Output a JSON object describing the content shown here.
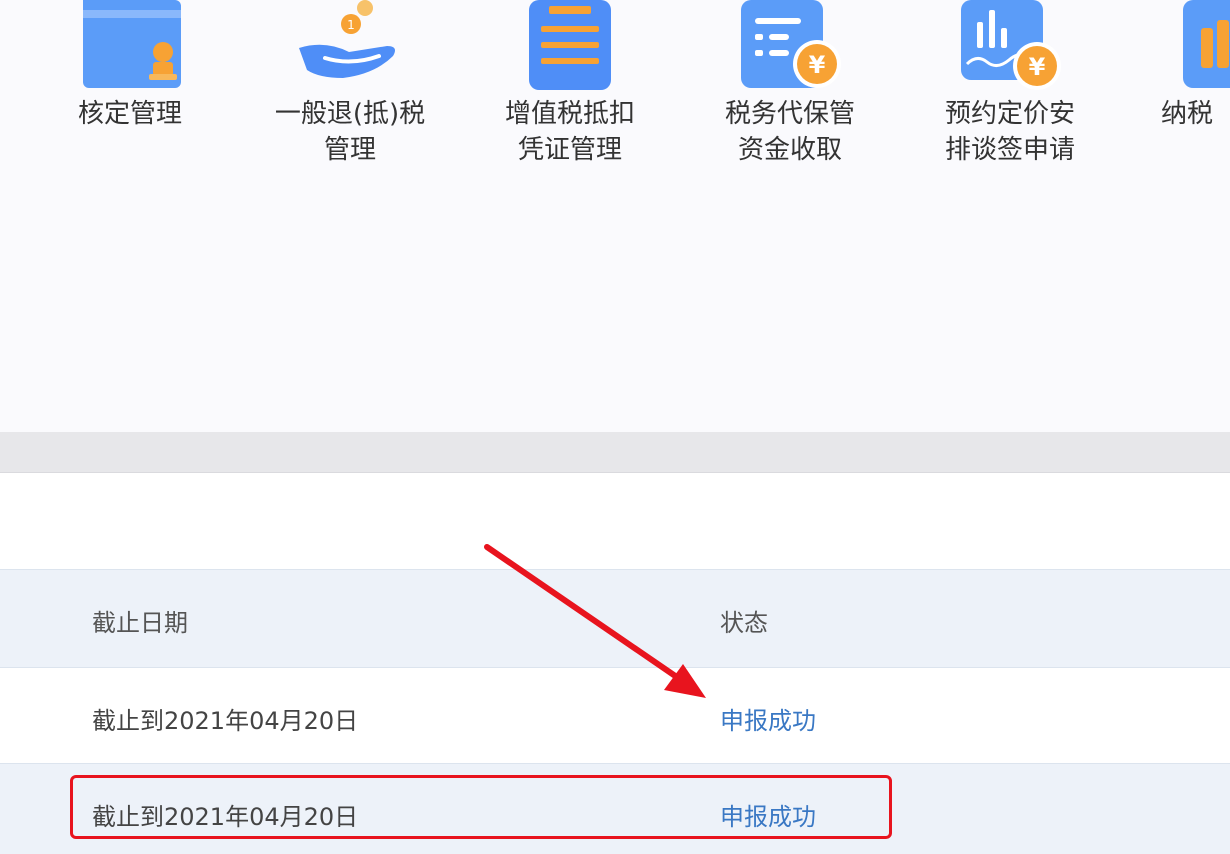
{
  "menu": {
    "items": [
      {
        "label_line1": "核定管理",
        "label_line2": "",
        "icon": "folder-stamp-icon"
      },
      {
        "label_line1": "一般退(抵)税",
        "label_line2": "管理",
        "icon": "hand-coins-icon"
      },
      {
        "label_line1": "增值税抵扣",
        "label_line2": "凭证管理",
        "icon": "receipt-icon"
      },
      {
        "label_line1": "税务代保管",
        "label_line2": "资金收取",
        "icon": "document-yen-icon"
      },
      {
        "label_line1": "预约定价安",
        "label_line2": "排谈签申请",
        "icon": "chart-yen-icon"
      },
      {
        "label_line1": "纳税",
        "label_line2": "",
        "icon": "partial-icon"
      }
    ]
  },
  "table": {
    "headers": {
      "deadline": "截止日期",
      "status": "状态"
    },
    "rows": [
      {
        "deadline": "截止到2021年04月20日",
        "status": "申报成功"
      },
      {
        "deadline": "截止到2021年04月20日",
        "status": "申报成功"
      }
    ]
  },
  "colors": {
    "highlight": "#e8141e",
    "link": "#3a78c4",
    "icon_blue": "#4f8ef7",
    "icon_orange": "#f7a234"
  }
}
